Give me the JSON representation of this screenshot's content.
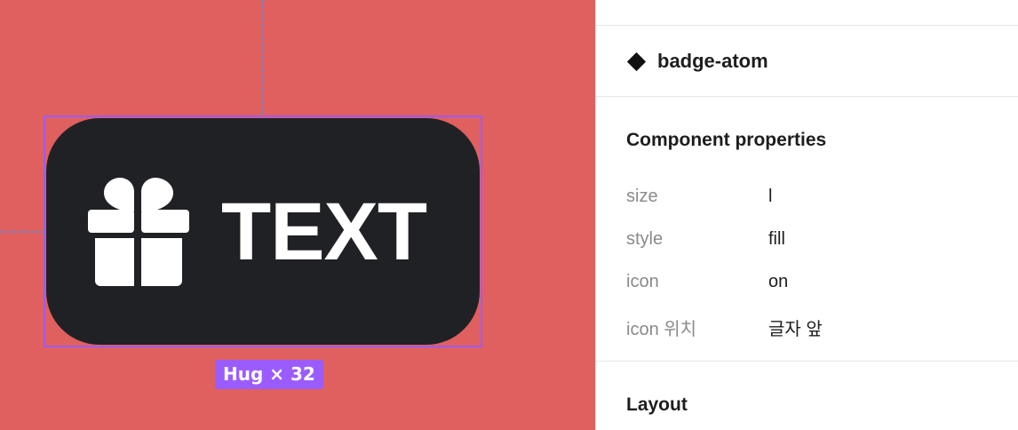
{
  "canvas": {
    "badge": {
      "label": "TEXT",
      "icon": "gift-icon"
    },
    "size_tag": "Hug × 32",
    "colors": {
      "canvas_bg": "#e05f5f",
      "badge_bg": "#202125",
      "selection": "#9b5cff",
      "guide": "#5b8ad8"
    }
  },
  "panel": {
    "component": {
      "icon": "component-diamond-icon",
      "name": "badge-atom"
    },
    "properties": {
      "title": "Component properties",
      "items": [
        {
          "label": "size",
          "value": "l"
        },
        {
          "label": "style",
          "value": "fill"
        },
        {
          "label": "icon",
          "value": "on"
        },
        {
          "label": "icon 위치",
          "value": "글자 앞"
        }
      ]
    },
    "layout": {
      "title": "Layout"
    }
  }
}
